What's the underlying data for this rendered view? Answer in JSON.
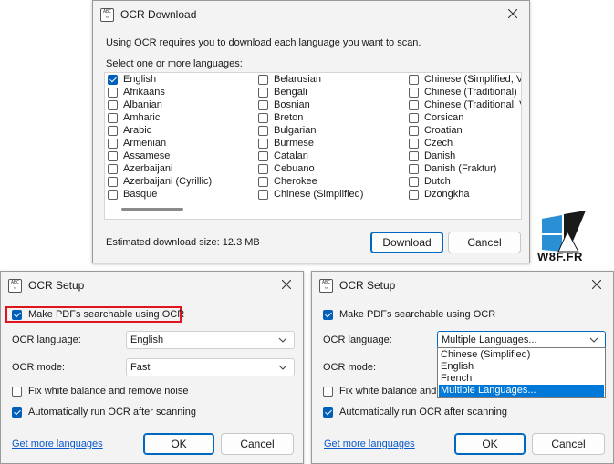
{
  "ocr_download": {
    "title": "OCR Download",
    "icon": "abc-scan-icon",
    "intro": "Using OCR requires you to download each language you want to scan.",
    "select_label": "Select one or more languages:",
    "languages": [
      {
        "label": "English",
        "checked": true
      },
      {
        "label": "Afrikaans",
        "checked": false
      },
      {
        "label": "Albanian",
        "checked": false
      },
      {
        "label": "Amharic",
        "checked": false
      },
      {
        "label": "Arabic",
        "checked": false
      },
      {
        "label": "Armenian",
        "checked": false
      },
      {
        "label": "Assamese",
        "checked": false
      },
      {
        "label": "Azerbaijani",
        "checked": false
      },
      {
        "label": "Azerbaijani (Cyrillic)",
        "checked": false
      },
      {
        "label": "Basque",
        "checked": false
      },
      {
        "label": "Belarusian",
        "checked": false
      },
      {
        "label": "Bengali",
        "checked": false
      },
      {
        "label": "Bosnian",
        "checked": false
      },
      {
        "label": "Breton",
        "checked": false
      },
      {
        "label": "Bulgarian",
        "checked": false
      },
      {
        "label": "Burmese",
        "checked": false
      },
      {
        "label": "Catalan",
        "checked": false
      },
      {
        "label": "Cebuano",
        "checked": false
      },
      {
        "label": "Cherokee",
        "checked": false
      },
      {
        "label": "Chinese (Simplified)",
        "checked": false
      },
      {
        "label": "Chinese (Simplified, Ve",
        "checked": false
      },
      {
        "label": "Chinese (Traditional)",
        "checked": false
      },
      {
        "label": "Chinese (Traditional, V",
        "checked": false
      },
      {
        "label": "Corsican",
        "checked": false
      },
      {
        "label": "Croatian",
        "checked": false
      },
      {
        "label": "Czech",
        "checked": false
      },
      {
        "label": "Danish",
        "checked": false
      },
      {
        "label": "Danish (Fraktur)",
        "checked": false
      },
      {
        "label": "Dutch",
        "checked": false
      },
      {
        "label": "Dzongkha",
        "checked": false
      }
    ],
    "size_text": "Estimated download size: 12.3 MB",
    "download_button": "Download",
    "cancel_button": "Cancel"
  },
  "ocr_setup_left": {
    "title": "OCR Setup",
    "make_searchable": "Make PDFs searchable using OCR",
    "make_searchable_checked": true,
    "language_label": "OCR language:",
    "language_value": "English",
    "mode_label": "OCR mode:",
    "mode_value": "Fast",
    "fix_white": "Fix white balance and remove noise",
    "fix_white_checked": false,
    "auto_run": "Automatically run OCR after scanning",
    "auto_run_checked": true,
    "more_link": "Get more languages",
    "ok_button": "OK",
    "cancel_button": "Cancel"
  },
  "ocr_setup_right": {
    "title": "OCR Setup",
    "make_searchable": "Make PDFs searchable using OCR",
    "make_searchable_checked": true,
    "language_label": "OCR language:",
    "language_value": "Multiple Languages...",
    "mode_label": "OCR mode:",
    "fix_white": "Fix white balance and s",
    "fix_white_checked": false,
    "auto_run": "Automatically run OCR after scanning",
    "auto_run_checked": true,
    "dropdown_options": [
      "Chinese (Simplified)",
      "English",
      "French",
      "Multiple Languages..."
    ],
    "dropdown_selected": "Multiple Languages...",
    "more_link": "Get more languages",
    "ok_button": "OK",
    "cancel_button": "Cancel"
  },
  "watermark": {
    "text": "W8F.FR",
    "icon": "windows-logo-icon"
  },
  "colors": {
    "accent": "#005fb8",
    "highlight_border": "#e0141e",
    "dropdown_selection": "#0078d7",
    "link": "#0a58ca"
  }
}
